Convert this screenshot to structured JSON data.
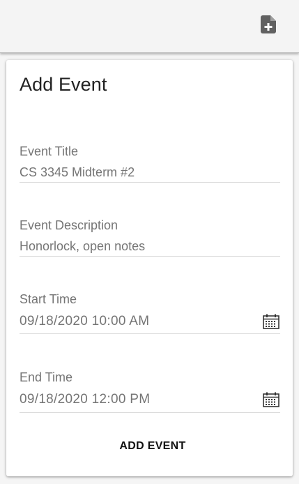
{
  "topbar": {
    "action_icon": "add-document-icon"
  },
  "form": {
    "title": "Add Event",
    "event_title": {
      "label": "Event Title",
      "value": "CS 3345 Midterm #2"
    },
    "event_description": {
      "label": "Event Description",
      "value": "Honorlock, open notes"
    },
    "start_time": {
      "label": "Start Time",
      "value": "09/18/2020 10:00 AM",
      "icon": "calendar-icon"
    },
    "end_time": {
      "label": "End Time",
      "value": "09/18/2020 12:00 PM",
      "icon": "calendar-icon"
    },
    "submit_label": "ADD EVENT"
  },
  "colors": {
    "text_primary": "#222222",
    "text_secondary": "#757575",
    "divider": "#dcdcdc"
  }
}
